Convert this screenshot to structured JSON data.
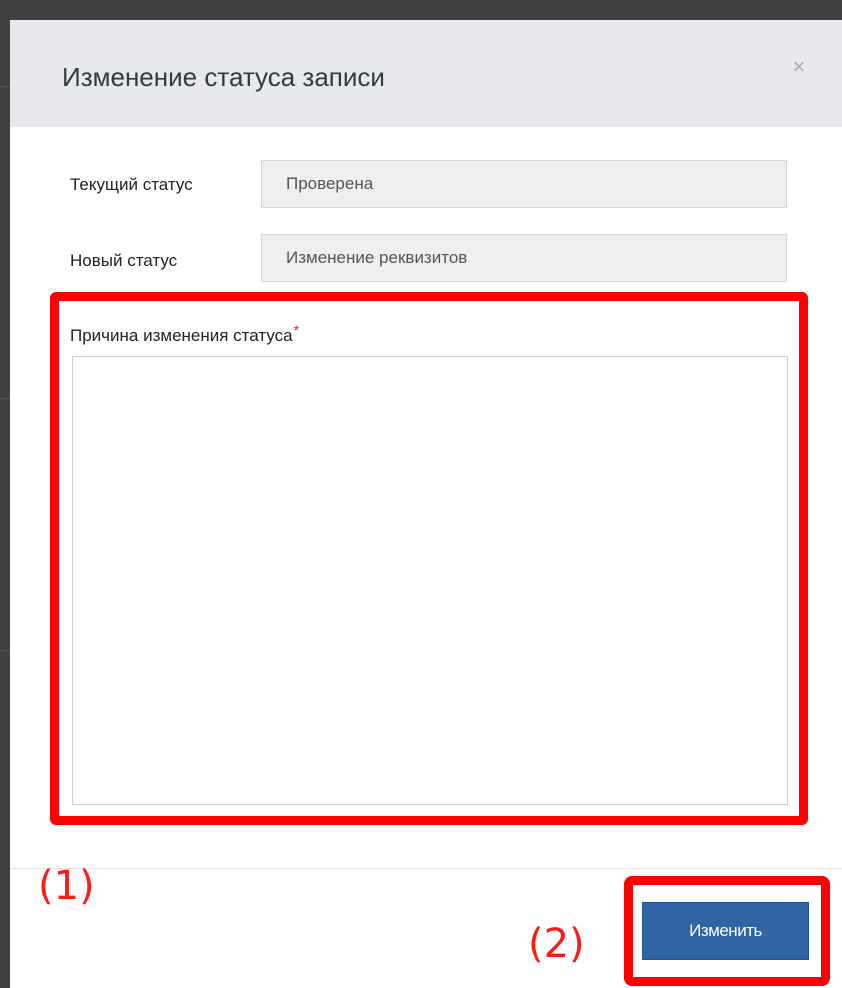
{
  "modal": {
    "title": "Изменение статуса записи",
    "close_icon_glyph": "×"
  },
  "form": {
    "current_status": {
      "label": "Текущий статус",
      "value": "Проверена"
    },
    "new_status": {
      "label": "Новый статус",
      "value": "Изменение реквизитов"
    },
    "reason": {
      "label": "Причина изменения статуса",
      "required_mark": "*",
      "value": ""
    }
  },
  "footer": {
    "submit_label": "Изменить"
  },
  "annotations": {
    "marker_1": "(1)",
    "marker_2": "(2)"
  },
  "colors": {
    "header_bg": "#e7e9ec",
    "primary_button": "#2f64a5",
    "highlight": "#ff0000",
    "required_star": "#d9262b"
  }
}
